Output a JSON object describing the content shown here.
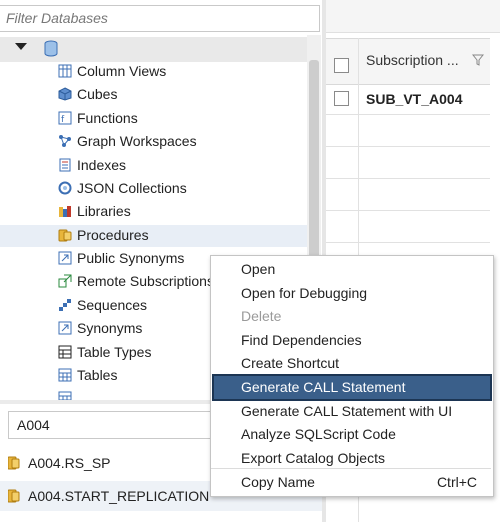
{
  "tree": {
    "filter_placeholder": "Filter Databases",
    "items": [
      {
        "label": "Column Views",
        "icon": "column-view-icon"
      },
      {
        "label": "Cubes",
        "icon": "cube-icon"
      },
      {
        "label": "Functions",
        "icon": "function-icon"
      },
      {
        "label": "Graph Workspaces",
        "icon": "graph-workspace-icon"
      },
      {
        "label": "Indexes",
        "icon": "index-icon"
      },
      {
        "label": "JSON Collections",
        "icon": "json-collection-icon"
      },
      {
        "label": "Libraries",
        "icon": "library-icon"
      },
      {
        "label": "Procedures",
        "icon": "procedure-icon"
      },
      {
        "label": "Public Synonyms",
        "icon": "public-synonym-icon"
      },
      {
        "label": "Remote Subscriptions",
        "icon": "remote-subscription-icon"
      },
      {
        "label": "Sequences",
        "icon": "sequence-icon"
      },
      {
        "label": "Synonyms",
        "icon": "synonym-icon"
      },
      {
        "label": "Table Types",
        "icon": "table-type-icon"
      },
      {
        "label": "Tables",
        "icon": "table-icon"
      }
    ]
  },
  "search": {
    "value": "A004",
    "results": [
      {
        "label": "A004.RS_SP"
      },
      {
        "label": "A004.START_REPLICATION"
      }
    ]
  },
  "grid": {
    "column_header": "Subscription ...",
    "rows": [
      {
        "name": "SUB_VT_A004"
      }
    ]
  },
  "context_menu": {
    "items": [
      {
        "label": "Open",
        "shortcut": ""
      },
      {
        "label": "Open for Debugging",
        "shortcut": ""
      },
      {
        "label": "Delete",
        "shortcut": ""
      },
      {
        "label": "Find Dependencies",
        "shortcut": ""
      },
      {
        "label": "Create Shortcut",
        "shortcut": ""
      },
      {
        "label": "Generate CALL Statement",
        "shortcut": ""
      },
      {
        "label": "Generate CALL Statement with UI",
        "shortcut": ""
      },
      {
        "label": "Analyze SQLScript Code",
        "shortcut": ""
      },
      {
        "label": "Export Catalog Objects",
        "shortcut": ""
      },
      {
        "label": "Copy Name",
        "shortcut": "Ctrl+C"
      }
    ]
  },
  "colors": {
    "highlight": "#3a5f8a",
    "icon_blue": "#3c6fb4",
    "icon_yellow": "#e8b53b"
  }
}
